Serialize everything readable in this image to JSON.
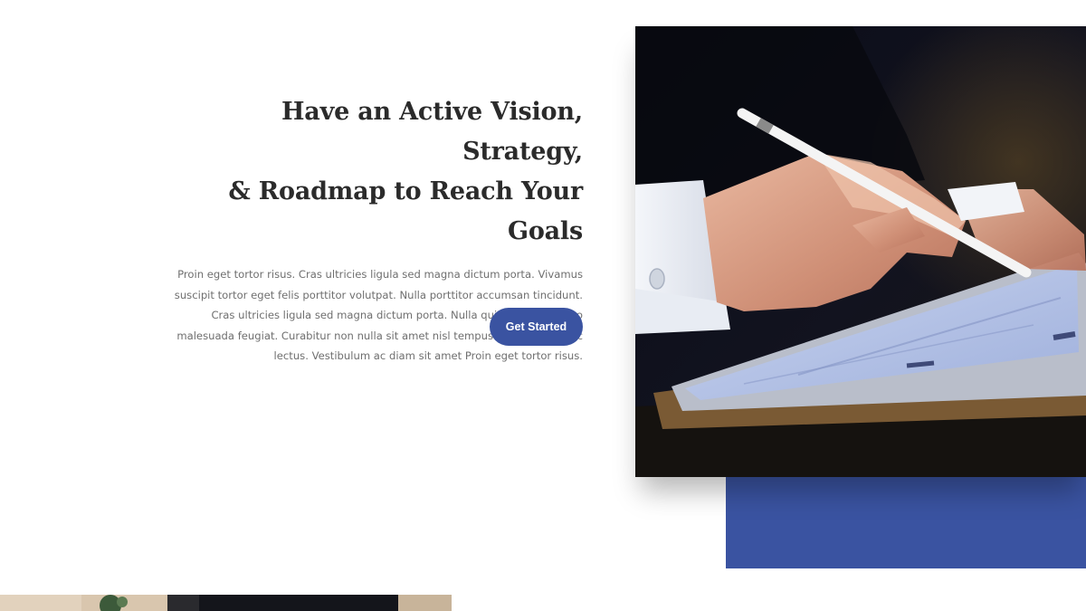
{
  "hero": {
    "headline_line1": "Have an Active Vision, Strategy,",
    "headline_line2": "& Roadmap to Reach Your Goals",
    "body_line1": "Proin eget tortor risus. Cras ultricies ligula sed magna dictum porta. Vivamus",
    "body_line2": "suscipit tortor eget felis porttitor volutpat. Nulla porttitor accumsan tincidunt.",
    "body_line3": "Cras ultricies ligula sed magna dictum porta. Nulla quis lorem ut libero",
    "body_line4": "malesuada feugiat. Curabitur non nulla sit amet nisl tempus convallis quis ac",
    "body_line5": "lectus. Vestibulum ac diam sit amet Proin eget tortor risus.",
    "cta_label": "Get Started"
  },
  "colors": {
    "accent": "#3a53a1",
    "heading": "#2b2b2b",
    "body": "#6f6f6f",
    "background": "#ffffff"
  },
  "images": {
    "hero_photo": "businessman-writing-on-tablet-with-stylus",
    "bottom_photo": "desk-with-plant-and-bag"
  }
}
